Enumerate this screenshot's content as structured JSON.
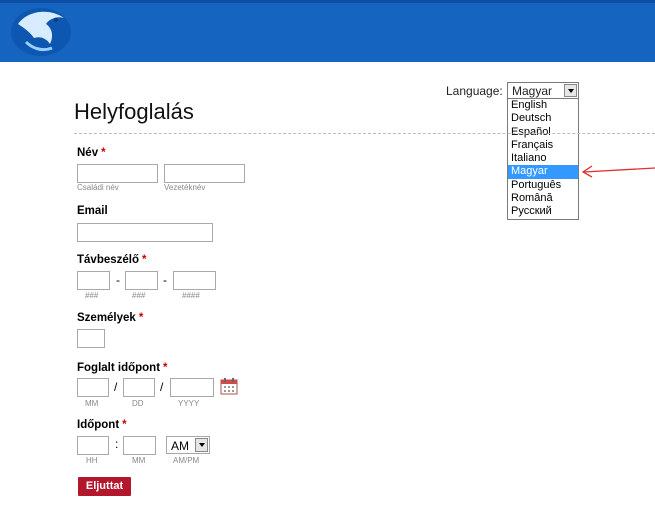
{
  "language": {
    "label": "Language:",
    "selected": "Magyar",
    "options": [
      "English",
      "Deutsch",
      "Español",
      "Français",
      "Italiano",
      "Magyar",
      "Português",
      "Română",
      "Русский"
    ]
  },
  "form": {
    "title": "Helyfoglalás",
    "name": {
      "label": "Név",
      "first_sub": "Családi név",
      "last_sub": "Vezetéknév"
    },
    "email": {
      "label": "Email"
    },
    "phone": {
      "label": "Távbeszélő",
      "sep": "-",
      "sub1": "###",
      "sub2": "###",
      "sub3": "####"
    },
    "persons": {
      "label": "Személyek"
    },
    "date": {
      "label": "Foglalt időpont",
      "sep": "/",
      "sub_mm": "MM",
      "sub_dd": "DD",
      "sub_yyyy": "YYYY"
    },
    "time": {
      "label": "Időpont",
      "sep": ":",
      "sub_hh": "HH",
      "sub_mm": "MM",
      "ampm_value": "AM",
      "ampm_sub": "AM/PM"
    },
    "required_mark": "*",
    "submit_label": "Eljuttat"
  },
  "colors": {
    "header": "#1565c0",
    "accent_red": "#b2172b",
    "highlight": "#3399ff"
  }
}
